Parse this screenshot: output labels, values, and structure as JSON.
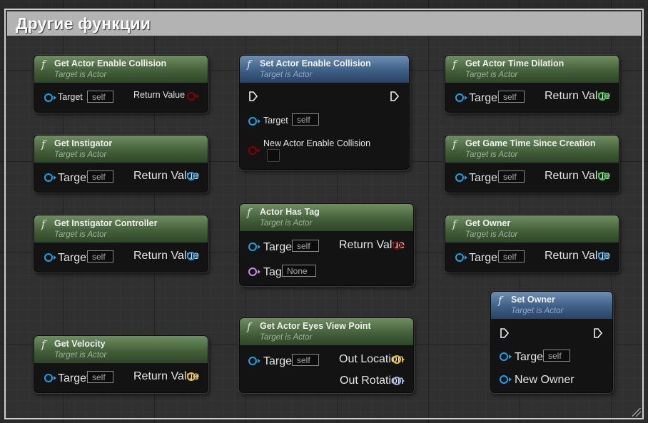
{
  "comment": {
    "title": "Другие функции"
  },
  "colors": {
    "object_pin": "#1fa3e8",
    "bool_pin": "#8a0000",
    "float_pin": "#36d63a",
    "vector_pin": "#f5c211",
    "rotator_pin": "#9ab2e6",
    "name_pin": "#c98bf2",
    "pure_header": "#44603a",
    "impure_header": "#3e5f86"
  },
  "nodes": {
    "get_actor_enable_collision": {
      "title": "Get Actor Enable Collision",
      "subtitle": "Target is Actor",
      "target_label": "Target",
      "target_value": "self",
      "return_label": "Return Value"
    },
    "get_instigator": {
      "title": "Get Instigator",
      "subtitle": "Target is Actor",
      "target_label": "Target",
      "target_value": "self",
      "return_label": "Return Value"
    },
    "get_instigator_controller": {
      "title": "Get Instigator Controller",
      "subtitle": "Target is Actor",
      "target_label": "Target",
      "target_value": "self",
      "return_label": "Return Value"
    },
    "get_velocity": {
      "title": "Get Velocity",
      "subtitle": "Target is Actor",
      "target_label": "Target",
      "target_value": "self",
      "return_label": "Return Value"
    },
    "set_actor_enable_collision": {
      "title": "Set Actor Enable Collision",
      "subtitle": "Target is Actor",
      "target_label": "Target",
      "target_value": "self",
      "param_label": "New Actor Enable Collision"
    },
    "actor_has_tag": {
      "title": "Actor Has Tag",
      "subtitle": "Target is Actor",
      "target_label": "Target",
      "target_value": "self",
      "return_label": "Return Value",
      "tag_label": "Tag",
      "tag_value": "None"
    },
    "get_actor_eyes_view_point": {
      "title": "Get Actor Eyes View Point",
      "subtitle": "Target is Actor",
      "target_label": "Target",
      "target_value": "self",
      "out_location_label": "Out Location",
      "out_rotation_label": "Out Rotation"
    },
    "get_actor_time_dilation": {
      "title": "Get Actor Time Dilation",
      "subtitle": "Target is Actor",
      "target_label": "Target",
      "target_value": "self",
      "return_label": "Return Value"
    },
    "get_game_time_since_creation": {
      "title": "Get Game Time Since Creation",
      "subtitle": "Target is Actor",
      "target_label": "Target",
      "target_value": "self",
      "return_label": "Return Value"
    },
    "get_owner": {
      "title": "Get Owner",
      "subtitle": "Target is Actor",
      "target_label": "Target",
      "target_value": "self",
      "return_label": "Return Value"
    },
    "set_owner": {
      "title": "Set Owner",
      "subtitle": "Target is Actor",
      "target_label": "Target",
      "target_value": "self",
      "param_label": "New Owner"
    }
  }
}
